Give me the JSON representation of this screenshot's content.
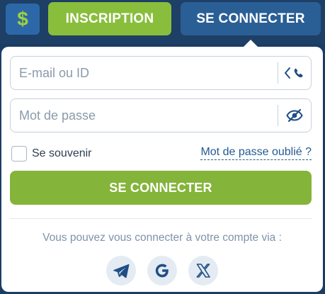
{
  "header": {
    "currency_symbol": "$",
    "register_label": "INSCRIPTION",
    "login_label": "SE CONNECTER"
  },
  "form": {
    "email_placeholder": "E-mail ou ID",
    "password_placeholder": "Mot de passe",
    "remember_label": "Se souvenir",
    "forgot_label": "Mot de passe oublié ?",
    "submit_label": "SE CONNECTER",
    "via_text": "Vous pouvez vous connecter à votre compte via :"
  },
  "socials": [
    {
      "name": "telegram-icon"
    },
    {
      "name": "google-icon"
    },
    {
      "name": "x-icon"
    }
  ],
  "colors": {
    "header_bg": "#1e3f66",
    "green": "#88be3c",
    "blue_button": "#2a5f96",
    "link": "#235a94"
  }
}
